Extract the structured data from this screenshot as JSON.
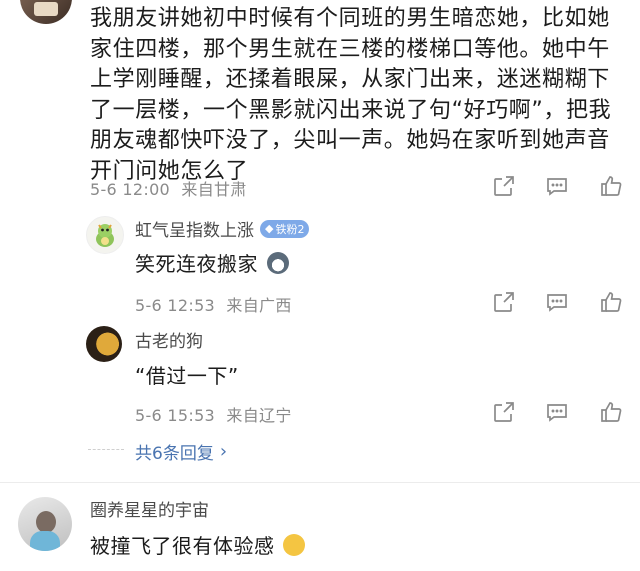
{
  "top_comment": {
    "username_partial": "",
    "body": "我朋友讲她初中时候有个同班的男生暗恋她，比如她家住四楼，那个男生就在三楼的楼梯口等他。她中午上学刚睡醒，还揉着眼屎，从家门出来，迷迷糊糊下了一层楼，一个黑影就闪出来说了句“好巧啊”，把我朋友魂都快吓没了，尖叫一声。她妈在家听到她声音开门问她怎么了",
    "time": "5-6 12:00",
    "location": "来自甘肃"
  },
  "replies": [
    {
      "username": "虹气呈指数上涨",
      "badge": "铁粉2",
      "text": "笑死连夜搬家",
      "time": "5-6 12:53",
      "location": "来自广西"
    },
    {
      "username": "古老的狗",
      "text": "“借过一下”",
      "time": "5-6 15:53",
      "location": "来自辽宁"
    }
  ],
  "more_replies_label": "共6条回复",
  "next_comment": {
    "username": "圈养星星的宇宙",
    "text": "被撞飞了很有体验感"
  },
  "colors": {
    "link_blue": "#4a74b0",
    "meta_gray": "#8a8a8a",
    "badge_blue": "#7ea9e8"
  }
}
